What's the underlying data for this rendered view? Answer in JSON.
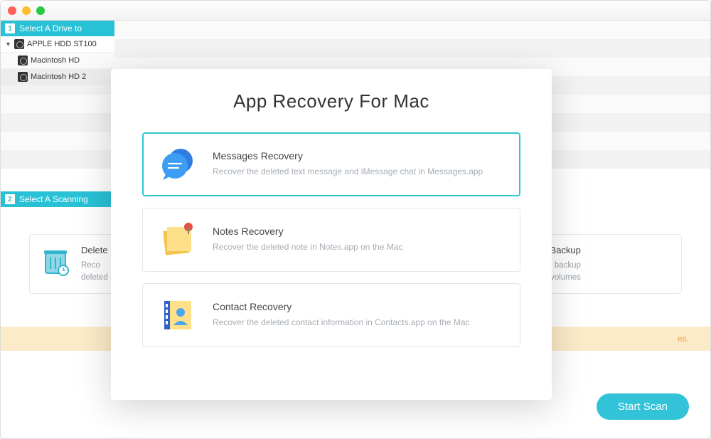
{
  "titlebar": {
    "close": "",
    "min": "",
    "max": ""
  },
  "sidebar": {
    "step1_num": "1",
    "step1_label": "Select A Drive to",
    "drives": [
      {
        "name": "APPLE HDD ST100",
        "root": true
      },
      {
        "name": "Macintosh HD",
        "root": false,
        "selected": false
      },
      {
        "name": "Macintosh HD 2",
        "root": false,
        "selected": true
      }
    ],
    "step2_num": "2",
    "step2_label": "Select A Scanning"
  },
  "cards_left": {
    "title": "Delete",
    "desc_l1": "Reco",
    "desc_l2": "deleted"
  },
  "cards_right": {
    "title": "ate Image Backup",
    "desc_l1": "ate an entire image backup",
    "desc_l2": "your hard disk or volumes"
  },
  "yellow_tail": "es.",
  "start_btn": "Start Scan",
  "modal": {
    "title": "App Recovery For Mac",
    "options": [
      {
        "title": "Messages Recovery",
        "desc": "Recover the deleted text message and iMessage chat in Messages.app",
        "selected": true,
        "icon": "messages"
      },
      {
        "title": "Notes Recovery",
        "desc": "Recover the deleted note in Notes.app on the Mac",
        "selected": false,
        "icon": "notes"
      },
      {
        "title": "Contact Recovery",
        "desc": "Recover the deleted contact information in Contacts.app on the Mac",
        "selected": false,
        "icon": "contacts"
      }
    ]
  }
}
